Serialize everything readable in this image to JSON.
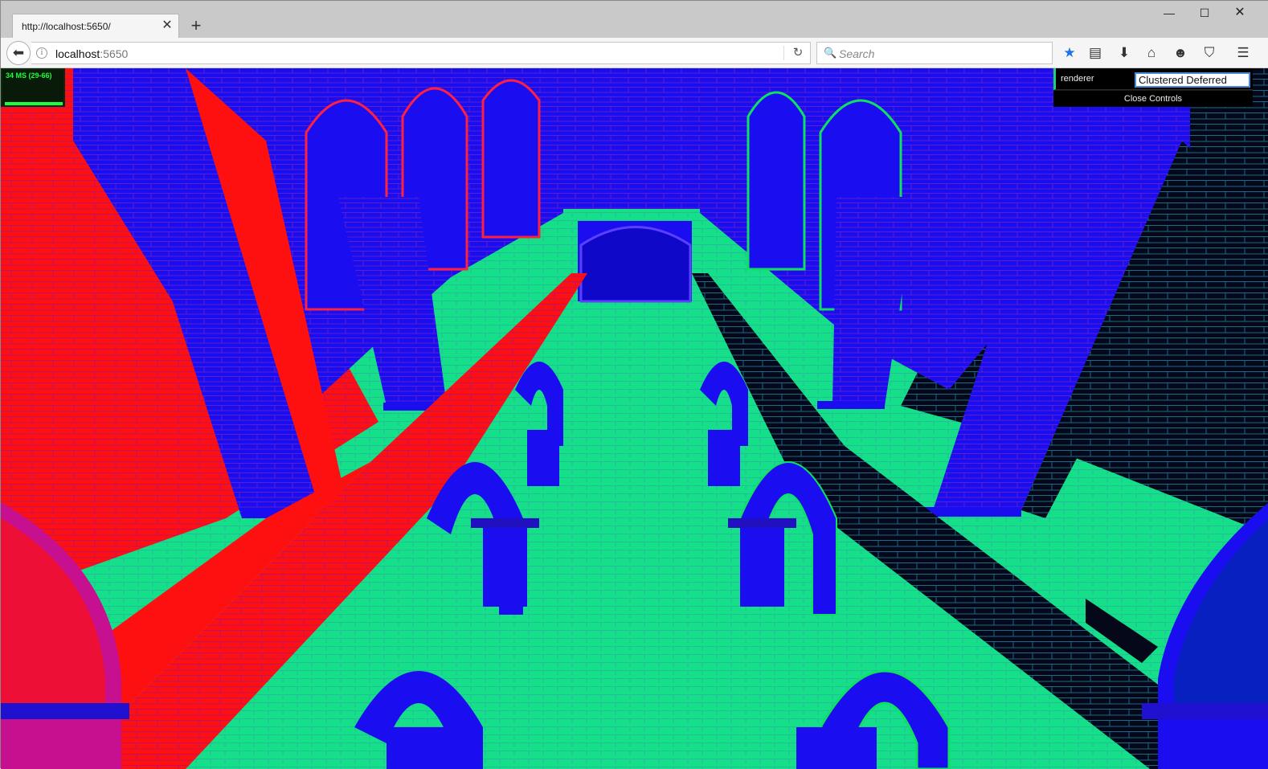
{
  "browser": {
    "tab_title": "http://localhost:5650/",
    "url_host": "localhost",
    "url_port": ":5650",
    "search_placeholder": "Search",
    "icons": [
      "back-icon",
      "info-icon",
      "reload-icon",
      "search-icon",
      "bookmark-star-icon",
      "reading-list-icon",
      "download-icon",
      "home-icon",
      "hello-icon",
      "pocket-icon",
      "menu-icon"
    ]
  },
  "stats": {
    "text": "34 MS (29-66)"
  },
  "gui": {
    "renderer_label": "renderer",
    "renderer_value": "Clustered Deferred",
    "close_label": "Close Controls"
  },
  "colors": {
    "floor": "#15e089",
    "wall_red": "#ff1010",
    "column_blue": "#1a0ef0",
    "wall_dark": "#050818",
    "gui_accent": "#1ed36f",
    "stats_green": "#1cff3a"
  }
}
